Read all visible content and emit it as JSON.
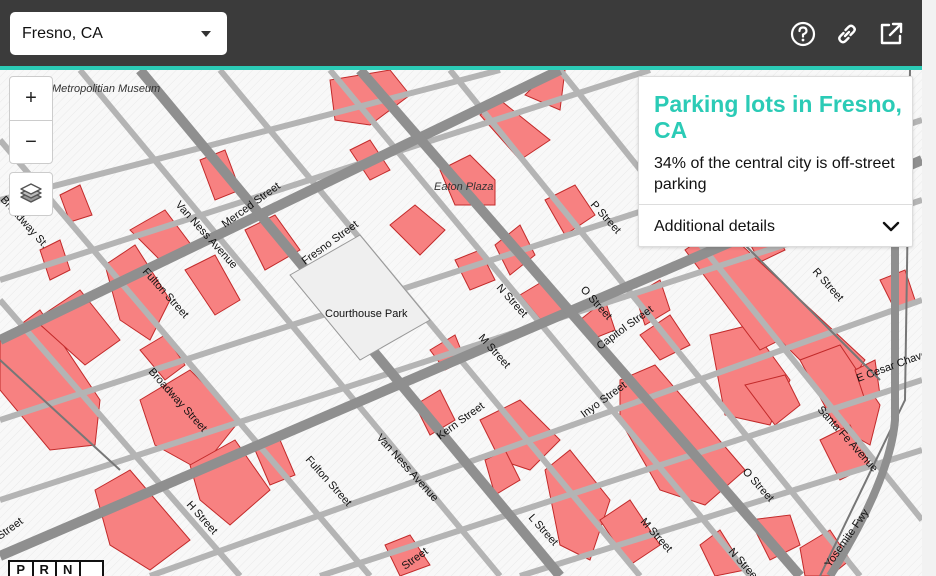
{
  "header": {
    "city_select": {
      "value": "Fresno, CA"
    },
    "icons": [
      "help-circle-icon",
      "link-icon",
      "external-link-icon"
    ],
    "bg_color": "#3b3b3b",
    "accent_color": "#2bcbb6"
  },
  "map": {
    "parking_color": "#f78181",
    "road_color": "#9a9a9a",
    "street_labels": [
      "Merced Street",
      "Van Ness Avenue",
      "Fresno Street",
      "Fulton Street",
      "Broadway Street",
      "H Street",
      "Kern Street",
      "M Street",
      "N Street",
      "O Street",
      "P Street",
      "Capitol Street",
      "Inyo Street",
      "R Street",
      "Santa Fe Avenue",
      "Yosemite Fwy",
      "L Street",
      "M Street",
      "O Street",
      "E Cesar Chavez",
      "Fulton Street",
      "Van Ness Avenue",
      "Broadway St.",
      "Street",
      "Street",
      "N Street"
    ],
    "place_labels": [
      "Courthouse Park",
      "Eaton Plaza",
      "Metropolitian Museum"
    ]
  },
  "controls": {
    "zoom_in": "+",
    "zoom_out": "−"
  },
  "panel": {
    "title": "Parking lots in Fresno, CA",
    "description": "34% of the central city is off-street parking",
    "details_label": "Additional details"
  },
  "logo": {
    "letters": [
      "P",
      "R",
      "N",
      ""
    ]
  }
}
